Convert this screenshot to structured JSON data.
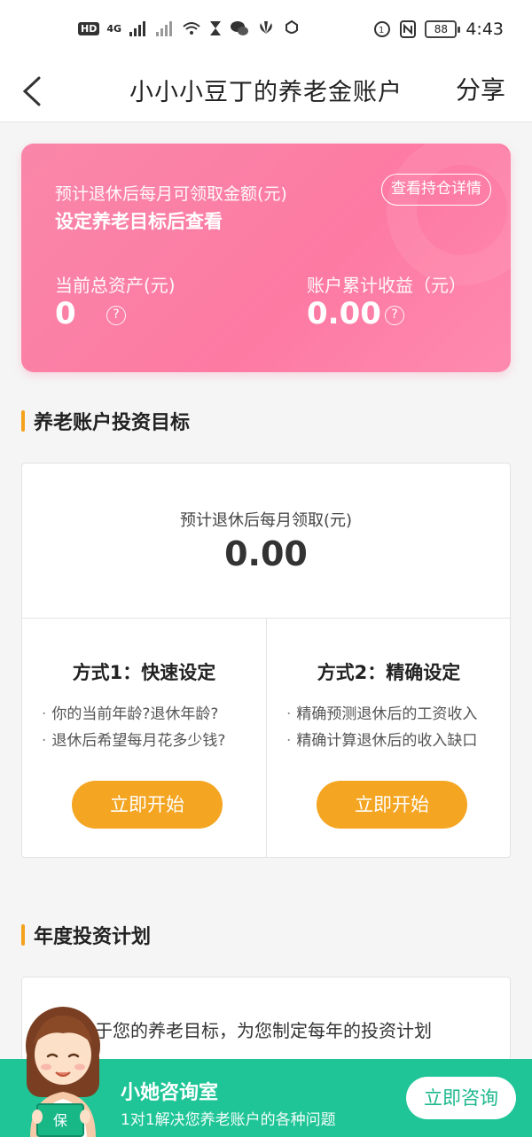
{
  "status_bar": {
    "hd": "HD",
    "network": "4G",
    "battery": "88",
    "time": "4:43"
  },
  "nav": {
    "title": "小小小豆丁的养老金账户",
    "share": "分享"
  },
  "summary": {
    "monthly_label": "预计退休后每月可领取金额(元)",
    "monthly_value": "设定养老目标后查看",
    "detail_button": "查看持仓详情",
    "total_assets_label": "当前总资产(元)",
    "total_assets_value": "0",
    "total_income_label": "账户累计收益（元）",
    "total_income_value": "0.00",
    "help": "?"
  },
  "goal_section": {
    "title": "养老账户投资目标",
    "monthly_label": "预计退休后每月领取(元)",
    "monthly_value": "0.00",
    "method1": {
      "title": "方式1：快速设定",
      "bullets": [
        "你的当前年龄?退休年龄?",
        "退休后希望每月花多少钱?"
      ],
      "button": "立即开始"
    },
    "method2": {
      "title": "方式2：精确设定",
      "bullets": [
        "精确预测退休后的工资收入",
        "精确计算退休后的收入缺口"
      ],
      "button": "立即开始"
    }
  },
  "plan_section": {
    "title": "年度投资计划",
    "text": "于您的养老目标，为您制定每年的投资计划"
  },
  "consult": {
    "title": "小她咨询室",
    "subtitle": "1对1解决您养老账户的各种问题",
    "button": "立即咨询",
    "book_label": "保"
  },
  "colors": {
    "pink": "#fd7aa3",
    "orange": "#f4a521",
    "green": "#1fc597"
  }
}
